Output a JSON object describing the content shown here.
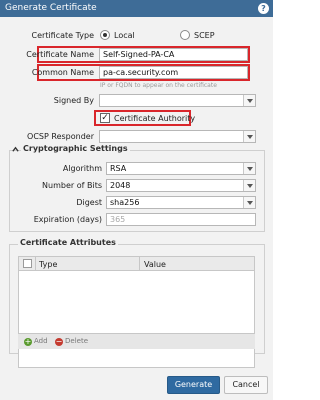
{
  "dialog": {
    "title": "Generate Certificate",
    "help_icon": "?"
  },
  "form": {
    "certificate_type": {
      "label": "Certificate Type",
      "options": [
        "Local",
        "SCEP"
      ],
      "selected": "Local"
    },
    "certificate_name": {
      "label": "Certificate Name",
      "value": "Self-Signed-PA-CA"
    },
    "common_name": {
      "label": "Common Name",
      "value": "pa-ca.security.com",
      "hint": "IP or FQDN to appear on the certificate"
    },
    "signed_by": {
      "label": "Signed By",
      "value": ""
    },
    "certificate_authority": {
      "label": "Certificate Authority",
      "checked": true
    },
    "ocsp_responder": {
      "label": "OCSP Responder",
      "value": ""
    }
  },
  "crypto": {
    "heading": "Cryptographic Settings",
    "algorithm": {
      "label": "Algorithm",
      "value": "RSA"
    },
    "number_of_bits": {
      "label": "Number of Bits",
      "value": "2048"
    },
    "digest": {
      "label": "Digest",
      "value": "sha256"
    },
    "expiration": {
      "label": "Expiration (days)",
      "value": "365"
    }
  },
  "attributes": {
    "heading": "Certificate Attributes",
    "columns": [
      "Type",
      "Value"
    ],
    "rows": [],
    "add_label": "Add",
    "delete_label": "Delete"
  },
  "buttons": {
    "generate": "Generate",
    "cancel": "Cancel"
  },
  "colors": {
    "titlebar": "#3e6c97",
    "highlight": "#d9262b",
    "primary_button": "#2f6aa1",
    "add_icon": "#5a9a2e",
    "delete_icon": "#c43a2f"
  }
}
